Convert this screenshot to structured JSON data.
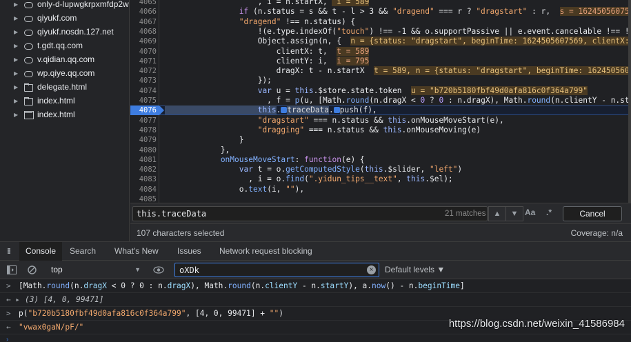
{
  "sidebar": {
    "items": [
      {
        "label": "only-d-lupwgkrpxmfdp2w",
        "icon": "cloud-icon",
        "type": "cloud",
        "arrow": "▶"
      },
      {
        "label": "qiyukf.com",
        "icon": "cloud-icon",
        "type": "cloud",
        "arrow": "▶"
      },
      {
        "label": "qiyukf.nosdn.127.net",
        "icon": "cloud-icon",
        "type": "cloud",
        "arrow": "▶"
      },
      {
        "label": "t.gdt.qq.com",
        "icon": "cloud-icon",
        "type": "cloud",
        "arrow": "▶"
      },
      {
        "label": "v.qidian.qq.com",
        "icon": "cloud-icon",
        "type": "cloud",
        "arrow": "▶"
      },
      {
        "label": "wp.qiye.qq.com",
        "icon": "cloud-icon",
        "type": "cloud",
        "arrow": "▶"
      },
      {
        "label": "delegate.html",
        "icon": "folder-icon",
        "type": "folder",
        "arrow": "▶"
      },
      {
        "label": "index.html",
        "icon": "folder-icon",
        "type": "folder",
        "arrow": "▶"
      },
      {
        "label": "index.html",
        "icon": "page-icon",
        "type": "page",
        "arrow": "▶"
      }
    ]
  },
  "editor": {
    "current_line": "4076",
    "lines": [
      {
        "n": "4065",
        "segs": [
          [
            "var",
            "                    , i = n.startX, "
          ],
          [
            "hl",
            " i = 589"
          ]
        ]
      },
      {
        "n": "4066",
        "segs": [
          [
            "kw",
            "                if"
          ],
          [
            "var",
            " (n.status = s && t - l > 3 && "
          ],
          [
            "str",
            "\"dragend\""
          ],
          [
            "var",
            " === r ? "
          ],
          [
            "str",
            "\"dragstart\""
          ],
          [
            "var",
            " : r,  "
          ],
          [
            "hl2",
            "s = 1624505607569"
          ]
        ]
      },
      {
        "n": "4067",
        "segs": [
          [
            "str",
            "                \"dragend\""
          ],
          [
            "var",
            " !== n.status) {"
          ]
        ]
      },
      {
        "n": "4068",
        "segs": [
          [
            "var",
            "                    !(e.type.indexOf("
          ],
          [
            "str",
            "\"touch\""
          ],
          [
            "var",
            ") !== -1 && o.supportPassive || e.event.cancelable !== !1"
          ]
        ]
      },
      {
        "n": "4069",
        "segs": [
          [
            "var",
            "                    Object.assign(n, {  "
          ],
          [
            "hl",
            "n = {status: \"dragstart\", beginTime: 1624505607569, clientX: 589"
          ]
        ]
      },
      {
        "n": "4070",
        "segs": [
          [
            "var",
            "                        clientX: t,  "
          ],
          [
            "hl2",
            "t = 589"
          ]
        ]
      },
      {
        "n": "4071",
        "segs": [
          [
            "var",
            "                        clientY: i,  "
          ],
          [
            "hl2",
            "i = 795"
          ]
        ]
      },
      {
        "n": "4072",
        "segs": [
          [
            "var",
            "                        dragX: t - n.startX  "
          ],
          [
            "hl",
            "t = 589, n = {status: \"dragstart\", beginTime: 1624505607569"
          ]
        ]
      },
      {
        "n": "4073",
        "segs": [
          [
            "var",
            "                    });"
          ]
        ]
      },
      {
        "n": "4074",
        "segs": [
          [
            "kw2",
            "                    var"
          ],
          [
            "var",
            " u = "
          ],
          [
            "kw2",
            "this"
          ],
          [
            "var",
            ".$store.state.token  "
          ],
          [
            "hl",
            "u = \"b720b5180fbf49d0afa816c0f364a799\""
          ]
        ]
      },
      {
        "n": "4075",
        "segs": [
          [
            "var",
            "                      , f = "
          ],
          [
            "fn",
            "p"
          ],
          [
            "var",
            "(u, [Math."
          ],
          [
            "fn",
            "round"
          ],
          [
            "var",
            "(n.dragX < "
          ],
          [
            "num",
            "0"
          ],
          [
            "var",
            " ? "
          ],
          [
            "num",
            "0"
          ],
          [
            "var",
            " : n.dragX), Math."
          ],
          [
            "fn",
            "round"
          ],
          [
            "var",
            "(n.clientY - n.startY)"
          ]
        ]
      },
      {
        "n": "4076",
        "segs": [
          [
            "kw2sel",
            "                    this"
          ],
          [
            "var",
            "."
          ],
          [
            "dot",
            ""
          ],
          [
            "seltxt",
            "traceData"
          ],
          [
            "var",
            "."
          ],
          [
            "dot",
            ""
          ],
          [
            "var",
            "push(f),"
          ]
        ]
      },
      {
        "n": "4077",
        "segs": [
          [
            "str",
            "                    \"dragstart\""
          ],
          [
            "var",
            " === n.status && "
          ],
          [
            "kw2",
            "this"
          ],
          [
            "var",
            ".onMouseMoveStart(e),"
          ]
        ]
      },
      {
        "n": "4078",
        "segs": [
          [
            "str",
            "                    \"dragging\""
          ],
          [
            "var",
            " === n.status && "
          ],
          [
            "kw2",
            "this"
          ],
          [
            "var",
            ".onMouseMoving(e)"
          ]
        ]
      },
      {
        "n": "4079",
        "segs": [
          [
            "var",
            "                }"
          ]
        ]
      },
      {
        "n": "4080",
        "segs": [
          [
            "var",
            "            },"
          ]
        ]
      },
      {
        "n": "4081",
        "segs": [
          [
            "fn",
            "            onMouseMoveStart"
          ],
          [
            "var",
            ": "
          ],
          [
            "kw",
            "function"
          ],
          [
            "var",
            "(e) {"
          ]
        ]
      },
      {
        "n": "4082",
        "segs": [
          [
            "kw2",
            "                var"
          ],
          [
            "var",
            " t = o."
          ],
          [
            "fn",
            "getComputedStyle"
          ],
          [
            "var",
            "("
          ],
          [
            "kw2",
            "this"
          ],
          [
            "var",
            ".$slider, "
          ],
          [
            "str",
            "\"left\""
          ],
          [
            "var",
            ")"
          ]
        ]
      },
      {
        "n": "4083",
        "segs": [
          [
            "var",
            "                  , i = o."
          ],
          [
            "fn",
            "find"
          ],
          [
            "var",
            "("
          ],
          [
            "str",
            "\".yidun_tips__text\""
          ],
          [
            "var",
            ", "
          ],
          [
            "kw2",
            "this"
          ],
          [
            "var",
            ".$el);"
          ]
        ]
      },
      {
        "n": "4084",
        "segs": [
          [
            "var",
            "                o."
          ],
          [
            "fn",
            "text"
          ],
          [
            "var",
            "(i, "
          ],
          [
            "str",
            "\"\""
          ],
          [
            "var",
            "),"
          ]
        ]
      },
      {
        "n": "4085",
        "segs": [
          [
            "var",
            "                "
          ]
        ]
      }
    ]
  },
  "search": {
    "query": "this.traceData",
    "match_count": "21 matches",
    "up_label": "▲",
    "down_label": "▼",
    "case_label": "Aa",
    "regex_label": ".*",
    "cancel_label": "Cancel"
  },
  "status": {
    "selection": "107 characters selected",
    "coverage": "Coverage: n/a"
  },
  "drawer": {
    "tabs": [
      "Console",
      "Search",
      "What's New",
      "Issues",
      "Network request blocking"
    ]
  },
  "console_toolbar": {
    "context": "top",
    "filter_value": "oXDk",
    "levels": "Default levels ▼"
  },
  "console": {
    "lines": [
      {
        "pfx": ">",
        "segs": [
          [
            "var",
            "[Math."
          ],
          [
            "fn",
            "round"
          ],
          [
            "var",
            "(n."
          ],
          [
            "prop",
            "dragX"
          ],
          [
            "var",
            " < 0 ? 0 : n."
          ],
          [
            "prop",
            "dragX"
          ],
          [
            "var",
            "), Math."
          ],
          [
            "fn",
            "round"
          ],
          [
            "var",
            "(n."
          ],
          [
            "prop",
            "clientY"
          ],
          [
            "var",
            " - n."
          ],
          [
            "prop",
            "startY"
          ],
          [
            "var",
            "), a."
          ],
          [
            "fn",
            "now"
          ],
          [
            "var",
            "() - n."
          ],
          [
            "prop",
            "beginTime"
          ],
          [
            "var",
            "]"
          ]
        ]
      },
      {
        "pfx": "← ▸",
        "segs": [
          [
            "ital",
            "(3) [4, 0, 99471]"
          ]
        ]
      },
      {
        "pfx": ">",
        "segs": [
          [
            "var",
            "p("
          ],
          [
            "str",
            "\"b720b5180fbf49d0afa816c0f364a799\""
          ],
          [
            "var",
            ", [4, 0, 99471] + "
          ],
          [
            "str",
            "\"\""
          ],
          [
            "var",
            ")"
          ]
        ]
      },
      {
        "pfx": "←",
        "segs": [
          [
            "str",
            "\"vwax0gaN/pF/\""
          ]
        ]
      }
    ],
    "prompt": "›",
    "watermark": "https://blog.csdn.net/weixin_41586984"
  },
  "colors": {
    "accent": "#3e7de0",
    "background": "#202124",
    "string": "#f2a86d",
    "keyword": "#c792ea"
  }
}
